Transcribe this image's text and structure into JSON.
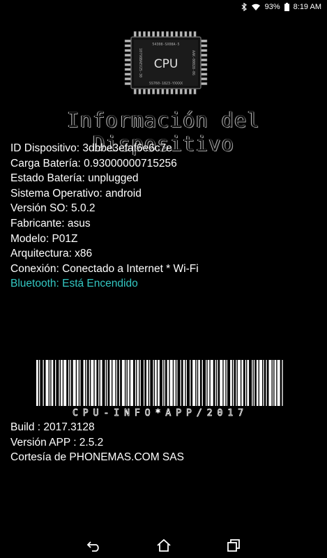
{
  "status_bar": {
    "battery_percent": "93%",
    "time": "8:19 AM",
    "icons": [
      "bluetooth-icon",
      "wifi-icon",
      "battery-icon"
    ]
  },
  "chip": {
    "label": "CPU",
    "top_text": "54308-SX08A-5",
    "left_text": "10798BAEV25-30",
    "right_text": "AAK-00028-06",
    "bottom_text": "SS760-1823-YXXXX"
  },
  "title": "Información del Dispositivo",
  "info": {
    "device_id": "ID Dispositivo: 3dbbe3efaf6e6c7e",
    "battery_charge": "Carga Batería: 0.93000000715256",
    "battery_state": "Estado Batería: unplugged",
    "os": "Sistema Operativo: android",
    "os_version": "Versión SO: 5.0.2",
    "manufacturer": "Fabricante: asus",
    "model": "Modelo: P01Z",
    "architecture": "Arquitectura: x86",
    "connection": "Conexión:  Conectado a Internet * Wi-Fi",
    "bluetooth": "Bluetooth: Está Encendido"
  },
  "colors": {
    "bluetooth_text": "#33c7c2",
    "background": "#000000"
  },
  "barcode_text": "CPU-INFO*APP/2017",
  "footer": {
    "build": "Build : 2017.3128",
    "app_version": "Versión APP : 2.5.2",
    "courtesy": "Cortesía de PHONEMAS.COM SAS"
  },
  "nav": [
    "back-icon",
    "home-icon",
    "recents-icon"
  ]
}
